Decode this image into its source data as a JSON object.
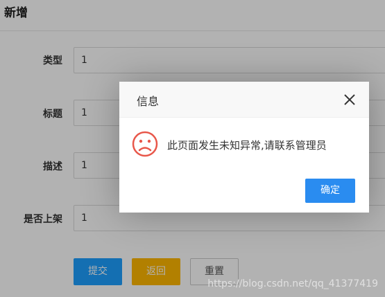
{
  "page": {
    "title": "新增"
  },
  "form": {
    "fields": [
      {
        "label": "类型",
        "value": "1"
      },
      {
        "label": "标题",
        "value": "1"
      },
      {
        "label": "描述",
        "value": "1"
      },
      {
        "label": "是否上架",
        "value": "1"
      }
    ],
    "buttons": {
      "submit": "提交",
      "back": "返回",
      "reset": "重置"
    }
  },
  "dialog": {
    "title": "信息",
    "message": "此页面发生未知异常,请联系管理员",
    "ok": "确定",
    "icon": "sad-face-icon",
    "close_icon": "close-icon"
  },
  "watermark": "https://blog.csdn.net/qq_41377419",
  "colors": {
    "submit": "#1e9fff",
    "back": "#ffb800",
    "ok": "#2a8cf0",
    "sad_icon": "#e8574a"
  }
}
